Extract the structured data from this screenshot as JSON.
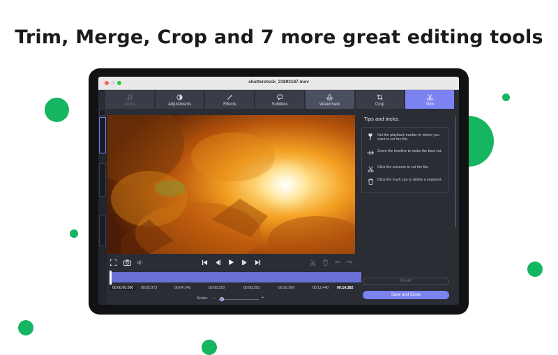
{
  "headline": "Trim, Merge, Crop and 7 more great editing tools",
  "window": {
    "title": "shutterstock_31893187.mov"
  },
  "toolbar": {
    "tabs": [
      {
        "label": "Audio"
      },
      {
        "label": "Adjustments"
      },
      {
        "label": "Effects"
      },
      {
        "label": "Subtitles"
      },
      {
        "label": "Watermark"
      },
      {
        "label": "Crop"
      },
      {
        "label": "Trim"
      }
    ]
  },
  "timeline": {
    "ticks": [
      "00:00:00.000",
      "00:02.073",
      "00:04.146",
      "00:06.220",
      "00:08.293",
      "00:10.366",
      "00:12.440",
      "00:14.382"
    ]
  },
  "scale": {
    "label": "Scale:",
    "minus": "–",
    "plus": "+"
  },
  "panel": {
    "title": "Tips and tricks:",
    "tips": [
      {
        "icon": "marker-icon",
        "text": "Set the playback marker to where you want to cut the file."
      },
      {
        "icon": "zoom-timeline-icon",
        "text": "Zoom the timeline to make the best cut."
      },
      {
        "icon": "scissors-icon",
        "text": "Click the scissors to cut the file."
      },
      {
        "icon": "trash-icon",
        "text": "Click the trash can to delete a segment."
      }
    ],
    "reset_label": "Reset",
    "save_label": "Save and Close"
  },
  "colors": {
    "accent": "#7c82f0",
    "green_dot": "#16b561",
    "timeline": "#6970d6",
    "background_dark": "#2b2d35"
  }
}
